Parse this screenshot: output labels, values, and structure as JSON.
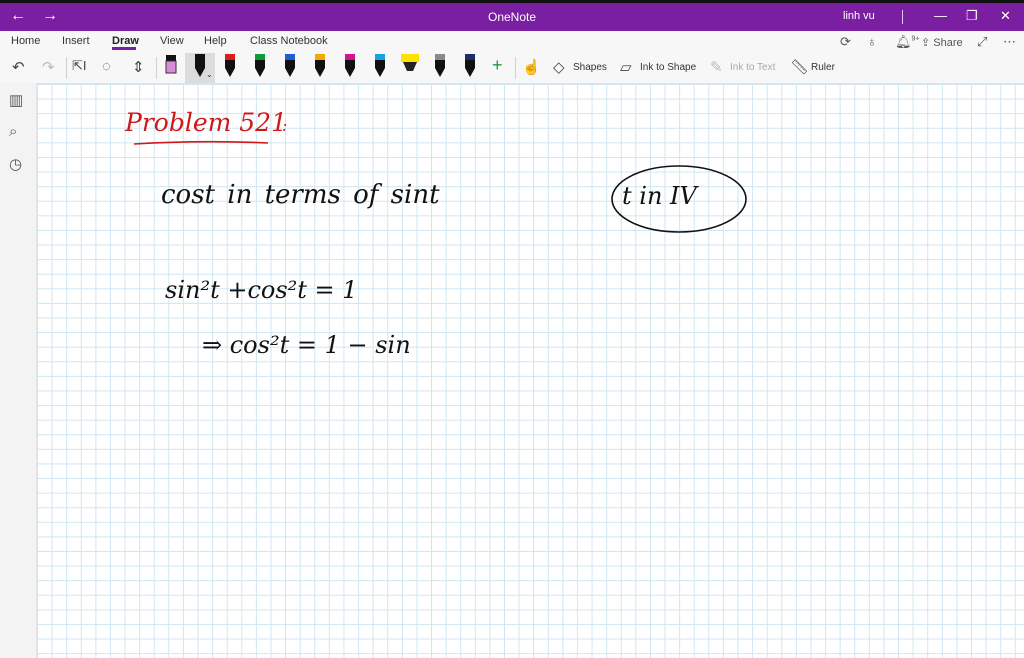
{
  "app": {
    "title": "OneNote",
    "user": "linh vu"
  },
  "ribbon": {
    "tabs": [
      "Home",
      "Insert",
      "Draw",
      "View",
      "Help",
      "Class Notebook"
    ],
    "active_tab": "Draw",
    "notification_count": "9+",
    "share_label": "Share"
  },
  "toolbar": {
    "shapes_label": "Shapes",
    "ink_to_shape_label": "Ink to Shape",
    "ink_to_text_label": "Ink to Text",
    "ruler_label": "Ruler",
    "pens": [
      {
        "name": "highlighter-pink",
        "color": "#d98cd8"
      },
      {
        "name": "pen-black-selected",
        "color": "#111111"
      },
      {
        "name": "pen-red",
        "color": "#e01b1b"
      },
      {
        "name": "pen-green",
        "color": "#0f9b3a"
      },
      {
        "name": "pen-blue",
        "color": "#1e5fd6"
      },
      {
        "name": "pen-orange",
        "color": "#f2a900"
      },
      {
        "name": "pen-magenta",
        "color": "#d4148f"
      },
      {
        "name": "pen-cyan",
        "color": "#17a3dd"
      },
      {
        "name": "highlighter-yellow",
        "color": "#ffe100"
      },
      {
        "name": "pen-gray",
        "color": "#8a8a8a"
      },
      {
        "name": "pen-navy",
        "color": "#1c2f6b"
      }
    ]
  },
  "sidebar": {
    "icons": [
      "notebooks-icon",
      "search-icon",
      "recent-icon"
    ]
  },
  "note": {
    "heading": "Problem 521",
    "heading_suffix": ":",
    "line1": "cost   in   terms   of   sint",
    "circled": "t   in   IV",
    "eq1": "sin²t  +cos²t  = 1",
    "eq2": "⇒  cos²t   =   1 − sin"
  },
  "colors": {
    "titlebar": "#7a1fa2",
    "ink_red": "#d01818",
    "grid": "#cfe6f2"
  }
}
